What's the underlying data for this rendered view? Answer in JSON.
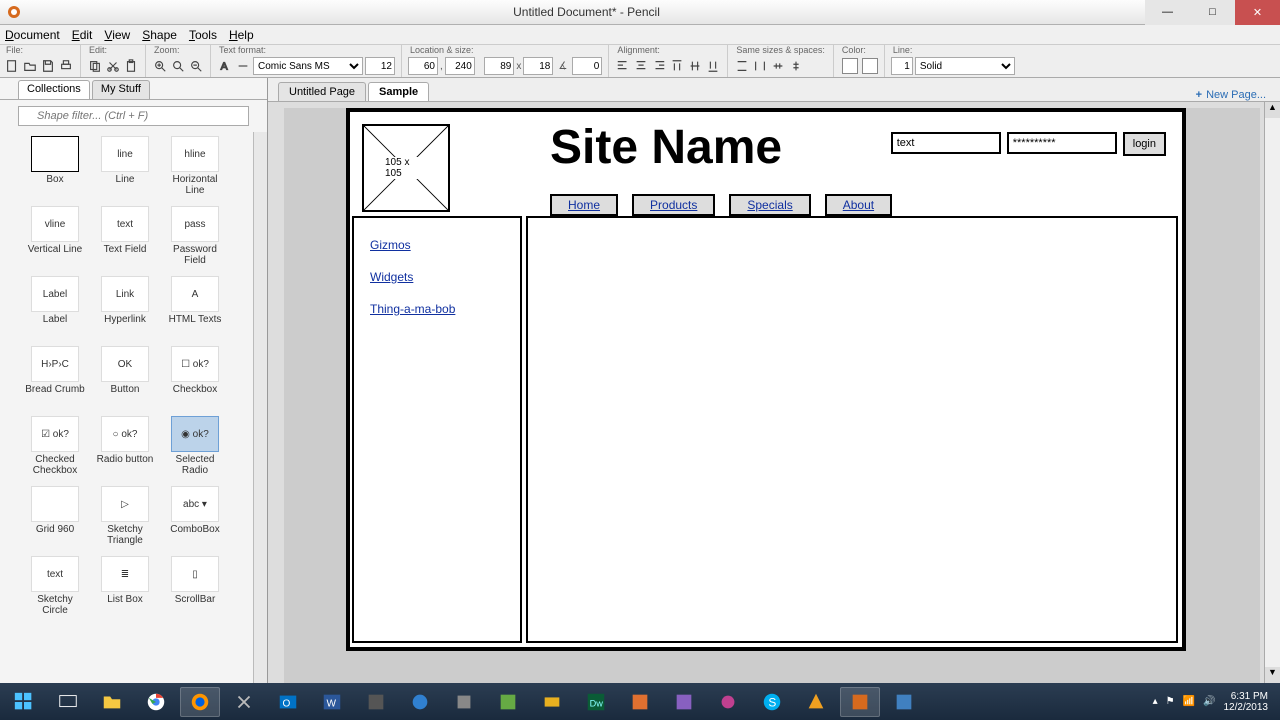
{
  "window": {
    "title": "Untitled Document* - Pencil",
    "minimize_label": "—",
    "maximize_label": "□",
    "close_label": "✕"
  },
  "menubar": [
    "Document",
    "Edit",
    "View",
    "Shape",
    "Tools",
    "Help"
  ],
  "toolbar": {
    "file_label": "File:",
    "edit_label": "Edit:",
    "zoom_label": "Zoom:",
    "textformat_label": "Text format:",
    "font": "Comic Sans MS",
    "fontsize": "12",
    "location_label": "Location & size:",
    "loc_x": "60",
    "loc_y": "240",
    "size_w": "89",
    "size_h": "18",
    "size_a": "0",
    "align_label": "Alignment:",
    "samesize_label": "Same sizes & spaces:",
    "color_label": "Color:",
    "line_label": "Line:",
    "line_w": "1",
    "line_style": "Solid"
  },
  "leftpanel": {
    "tab1": "Collections",
    "tab2": "My Stuff",
    "filter_placeholder": "Shape filter... (Ctrl + F)",
    "shapes": [
      {
        "name": "Box",
        "hint": "box"
      },
      {
        "name": "Line",
        "hint": "line"
      },
      {
        "name": "Horizontal Line",
        "hint": "hline"
      },
      {
        "name": "Vertical Line",
        "hint": "vline"
      },
      {
        "name": "Text Field",
        "hint": "text"
      },
      {
        "name": "Password Field",
        "hint": "pass"
      },
      {
        "name": "Label",
        "hint": "Label"
      },
      {
        "name": "Hyperlink",
        "hint": "Link"
      },
      {
        "name": "HTML Texts",
        "hint": "A"
      },
      {
        "name": "Bread Crumb",
        "hint": "H›P›C"
      },
      {
        "name": "Button",
        "hint": "OK"
      },
      {
        "name": "Checkbox",
        "hint": "☐ ok?"
      },
      {
        "name": "Checked Checkbox",
        "hint": "☑ ok?"
      },
      {
        "name": "Radio button",
        "hint": "○ ok?"
      },
      {
        "name": "Selected Radio",
        "hint": "◉ ok?",
        "selected": true
      },
      {
        "name": "Grid 960",
        "hint": ""
      },
      {
        "name": "Sketchy Triangle",
        "hint": "▷"
      },
      {
        "name": "ComboBox",
        "hint": "abc ▾"
      },
      {
        "name": "Sketchy Circle",
        "hint": "text"
      },
      {
        "name": "List Box",
        "hint": "≣"
      },
      {
        "name": "ScrollBar",
        "hint": "▯"
      }
    ]
  },
  "pagetabs": {
    "tab1": "Untitled Page",
    "tab2": "Sample",
    "newpage": "New Page..."
  },
  "mock": {
    "img_size": "105 x 105",
    "site_title": "Site Name",
    "login_text": "text",
    "login_pass": "**********",
    "login_btn": "login",
    "nav": [
      "Home",
      "Products",
      "Specials",
      "About"
    ],
    "sidelinks": [
      "Gizmos",
      "Widgets",
      "Thing-a-ma-bob"
    ]
  },
  "tray": {
    "time": "6:31 PM",
    "date": "12/2/2013"
  }
}
